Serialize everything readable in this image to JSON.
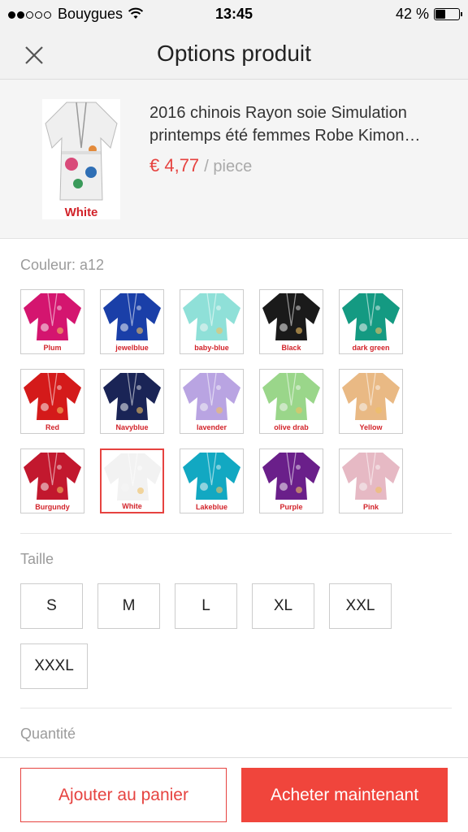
{
  "status_bar": {
    "carrier": "Bouygues",
    "time": "13:45",
    "battery": "42 %",
    "battery_level": 0.42
  },
  "header": {
    "title": "Options produit",
    "close_icon": "close-icon"
  },
  "product": {
    "title": "2016 chinois Rayon soie Simulation printemps été femmes Robe Kimon…",
    "price": "€ 4,77",
    "unit": "/ piece",
    "image_caption": "White"
  },
  "color": {
    "label": "Couleur: a12",
    "selected_index": 11,
    "options": [
      {
        "caption": "Plum",
        "color": "#d4156f"
      },
      {
        "caption": "jewelblue",
        "color": "#1a3fa8"
      },
      {
        "caption": "baby-blue",
        "color": "#8fe0d8"
      },
      {
        "caption": "Black",
        "color": "#1a1a1a"
      },
      {
        "caption": "dark green",
        "color": "#149a82"
      },
      {
        "caption": "Red",
        "color": "#d41a1a"
      },
      {
        "caption": "Navyblue",
        "color": "#1a2456"
      },
      {
        "caption": "lavender",
        "color": "#b9a4e2"
      },
      {
        "caption": "olive drab",
        "color": "#9ad68a"
      },
      {
        "caption": "Yellow",
        "color": "#e9b984"
      },
      {
        "caption": "Burgundy",
        "color": "#c2182e"
      },
      {
        "caption": "White",
        "color": "#f2f2f2"
      },
      {
        "caption": "Lakeblue",
        "color": "#12a8c2"
      },
      {
        "caption": "Purple",
        "color": "#6a1f8a"
      },
      {
        "caption": "Pink",
        "color": "#e6b9c4"
      }
    ]
  },
  "size": {
    "label": "Taille",
    "options": [
      "S",
      "M",
      "L",
      "XL",
      "XXL",
      "XXXL"
    ]
  },
  "quantity": {
    "label": "Quantité"
  },
  "actions": {
    "add_to_cart": "Ajouter au panier",
    "buy_now": "Acheter maintenant"
  },
  "colors": {
    "accent": "#e64340",
    "buy_button": "#f0453c"
  }
}
